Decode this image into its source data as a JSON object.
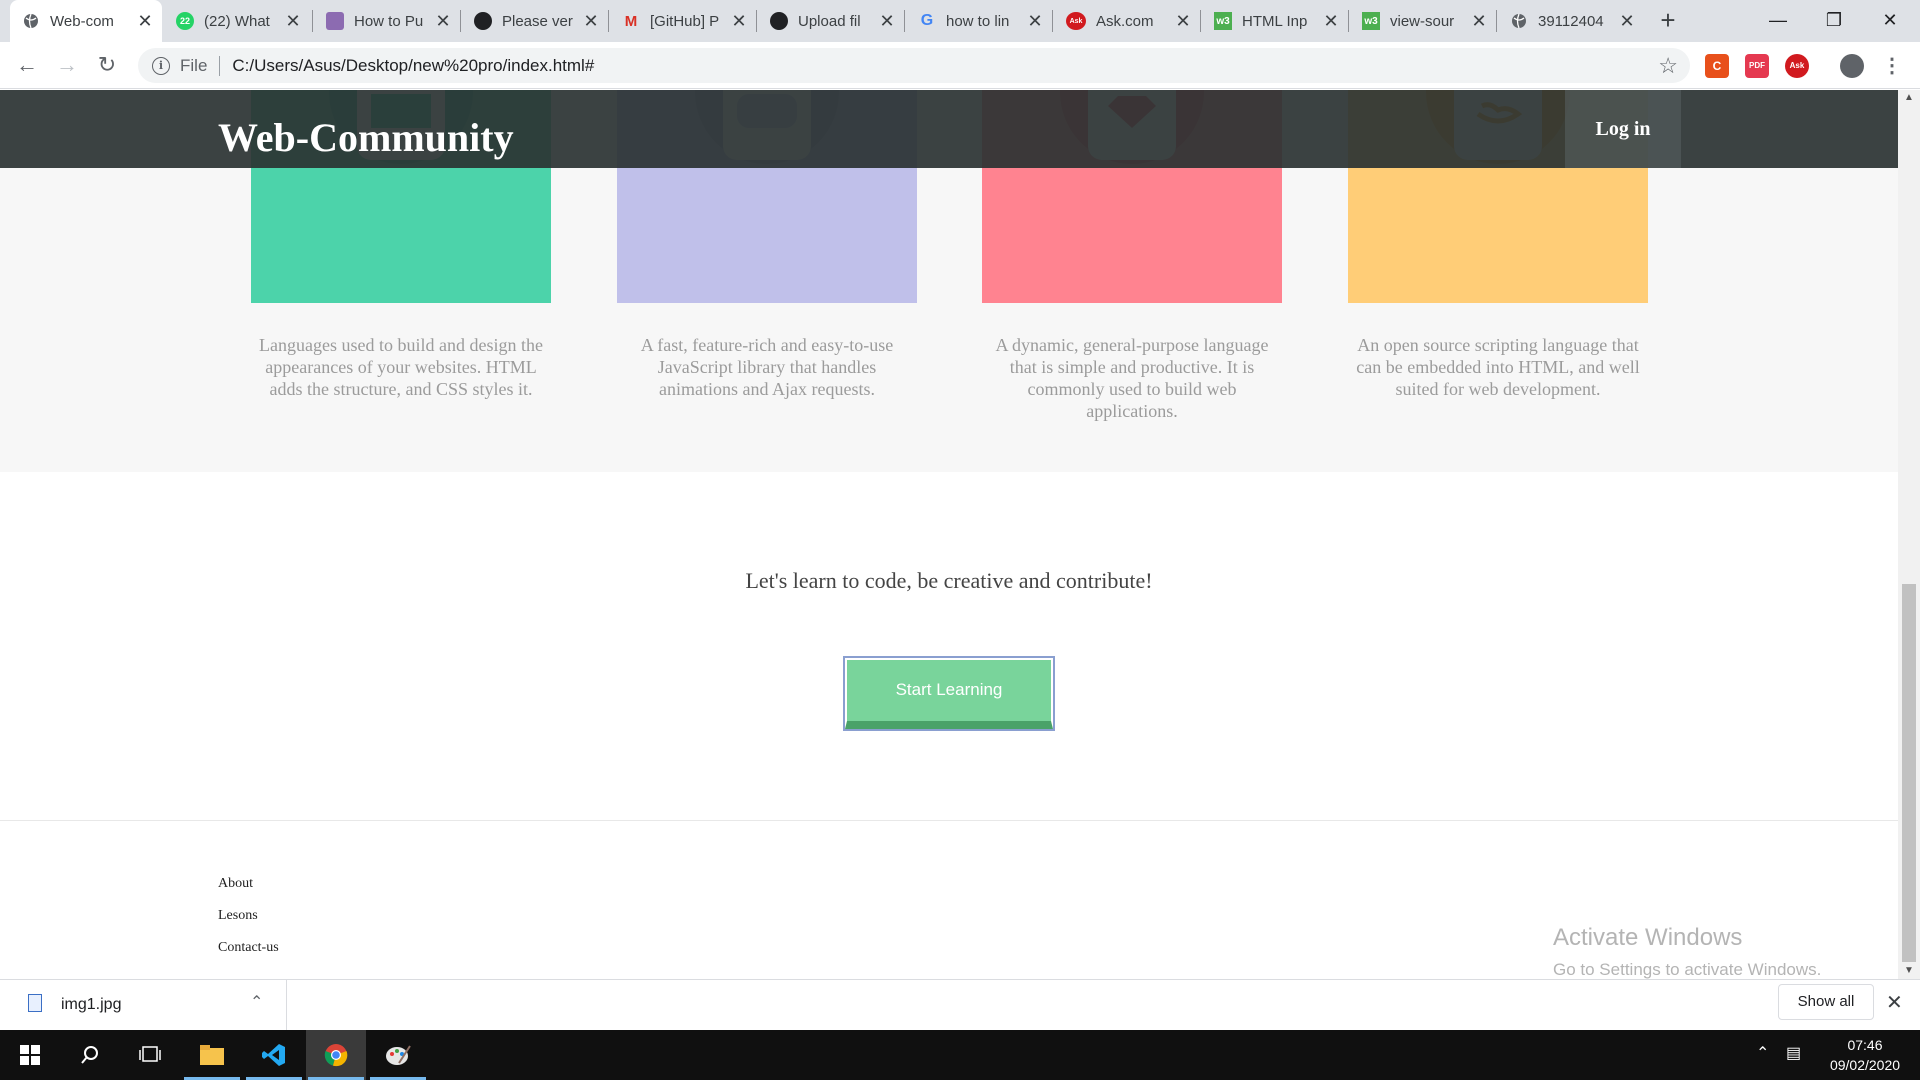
{
  "browser": {
    "tabs": [
      {
        "title": "Web-com",
        "favicon": "globe-icon",
        "fav_color": "#5f6368"
      },
      {
        "title": "(22) What",
        "favicon": "whatsapp-icon",
        "fav_color": "#25d366",
        "fav_text": "22"
      },
      {
        "title": "How to Pu",
        "favicon": "stack-icon",
        "fav_color": "#8c6bb1"
      },
      {
        "title": "Please ver",
        "favicon": "github-icon",
        "fav_color": "#202124"
      },
      {
        "title": "[GitHub] P",
        "favicon": "gmail-icon",
        "fav_color": "#d93025",
        "fav_text": "M"
      },
      {
        "title": "Upload fil",
        "favicon": "github-icon",
        "fav_color": "#202124"
      },
      {
        "title": "how to lin",
        "favicon": "google-icon",
        "fav_color": "#4285f4",
        "fav_text": "G"
      },
      {
        "title": "Ask.com",
        "favicon": "ask-icon",
        "fav_color": "#d11a1f",
        "fav_text": "Ask"
      },
      {
        "title": "HTML Inp",
        "favicon": "w3schools-icon",
        "fav_color": "#4caf50",
        "fav_text": "w3"
      },
      {
        "title": "view-sour",
        "favicon": "w3schools-icon",
        "fav_color": "#4caf50",
        "fav_text": "w3"
      },
      {
        "title": "39112404",
        "favicon": "globe-icon",
        "fav_color": "#5f6368"
      }
    ],
    "address": {
      "scheme_label": "File",
      "url": "C:/Users/Asus/Desktop/new%20pro/index.html#"
    }
  },
  "site": {
    "logo": "Web-Community",
    "login_label": "Log in",
    "cards": [
      {
        "bg": "#4cd3aa",
        "circle": "#2fbf96",
        "description": "Languages used to build and design the appearances of your websites. HTML adds the structure, and CSS styles it."
      },
      {
        "bg": "#c0c0ea",
        "circle": "#9f9fd8",
        "description": "A fast, feature-rich and easy-to-use JavaScript library that handles animations and Ajax requests."
      },
      {
        "bg": "#ff8390",
        "circle": "#e95466",
        "description": "A dynamic, general-purpose language that is simple and productive. It is commonly used to build web applications."
      },
      {
        "bg": "#ffcd77",
        "circle": "#ffa52c",
        "description": "An open source scripting language that can be embedded into HTML, and well suited for web development."
      }
    ],
    "cta_text": "Let's learn to code, be creative and contribute!",
    "cta_button": "Start Learning",
    "footer_links": [
      "About",
      "Lesons",
      "Contact-us"
    ]
  },
  "watermark": {
    "title": "Activate Windows",
    "subtitle": "Go to Settings to activate Windows."
  },
  "downloads": {
    "file_name": "img1.jpg",
    "show_all": "Show all"
  },
  "taskbar": {
    "time": "07:46",
    "date": "09/02/2020"
  }
}
